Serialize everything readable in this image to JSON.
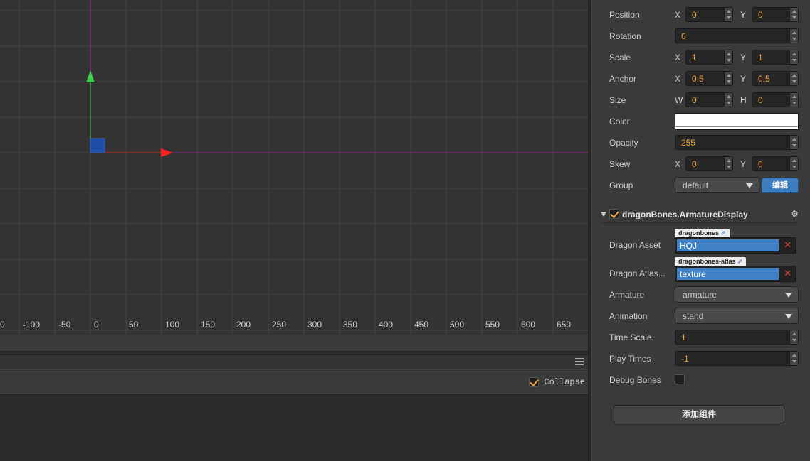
{
  "scene": {
    "ruler_ticks": [
      "0",
      "-100",
      "-50",
      "0",
      "50",
      "100",
      "150",
      "200",
      "250",
      "300",
      "350",
      "400",
      "450",
      "500",
      "550",
      "600",
      "650"
    ]
  },
  "console": {
    "collapse_label": "Collapse",
    "collapse_checked": true
  },
  "inspector": {
    "position": {
      "label": "Position",
      "x_axis": "X",
      "x": "0",
      "y_axis": "Y",
      "y": "0"
    },
    "rotation": {
      "label": "Rotation",
      "value": "0"
    },
    "scale": {
      "label": "Scale",
      "x_axis": "X",
      "x": "1",
      "y_axis": "Y",
      "y": "1"
    },
    "anchor": {
      "label": "Anchor",
      "x_axis": "X",
      "x": "0.5",
      "y_axis": "Y",
      "y": "0.5"
    },
    "size": {
      "label": "Size",
      "w_axis": "W",
      "w": "0",
      "h_axis": "H",
      "h": "0"
    },
    "color": {
      "label": "Color",
      "value": "#ffffff"
    },
    "opacity": {
      "label": "Opacity",
      "value": "255"
    },
    "skew": {
      "label": "Skew",
      "x_axis": "X",
      "x": "0",
      "y_axis": "Y",
      "y": "0"
    },
    "group": {
      "label": "Group",
      "value": "default",
      "edit_label": "编辑"
    },
    "component": {
      "title": "dragonBones.ArmatureDisplay",
      "enabled": true,
      "dragon_asset": {
        "label": "Dragon Asset",
        "tag": "dragonbones",
        "value": "HQJ"
      },
      "dragon_atlas": {
        "label": "Dragon Atlas...",
        "tag": "dragonbones-atlas",
        "value": "texture"
      },
      "armature": {
        "label": "Armature",
        "value": "armature"
      },
      "animation": {
        "label": "Animation",
        "value": "stand"
      },
      "time_scale": {
        "label": "Time Scale",
        "value": "1"
      },
      "play_times": {
        "label": "Play Times",
        "value": "-1"
      },
      "debug_bones": {
        "label": "Debug Bones",
        "checked": false
      }
    },
    "add_component_label": "添加组件"
  },
  "colors": {
    "accent_orange": "#f0a03a",
    "selection_blue": "#3f81c4",
    "axis_x": "#ff2020",
    "axis_y": "#3fcf4f",
    "axis_line": "#a020a0"
  }
}
